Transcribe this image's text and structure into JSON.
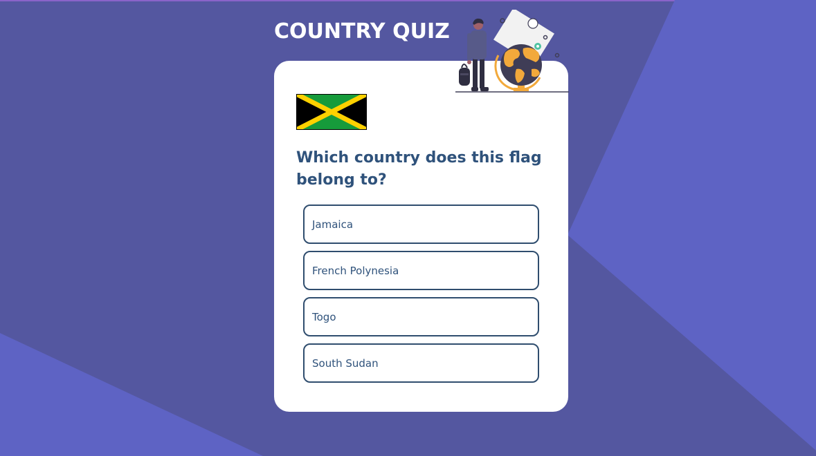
{
  "app": {
    "title": "COUNTRY QUIZ"
  },
  "quiz": {
    "flag_icon": "jamaica-flag-icon",
    "question": "Which country does this flag belong to?",
    "options": [
      {
        "label": "Jamaica"
      },
      {
        "label": "French Polynesia"
      },
      {
        "label": "Togo"
      },
      {
        "label": "South Sudan"
      }
    ]
  },
  "colors": {
    "background": "#5457a0",
    "background_light": "#5e63c4",
    "card": "#ffffff",
    "question_text": "#2f527b",
    "option_border": "#2f4d6e",
    "accent_orange": "#f2a93b"
  }
}
